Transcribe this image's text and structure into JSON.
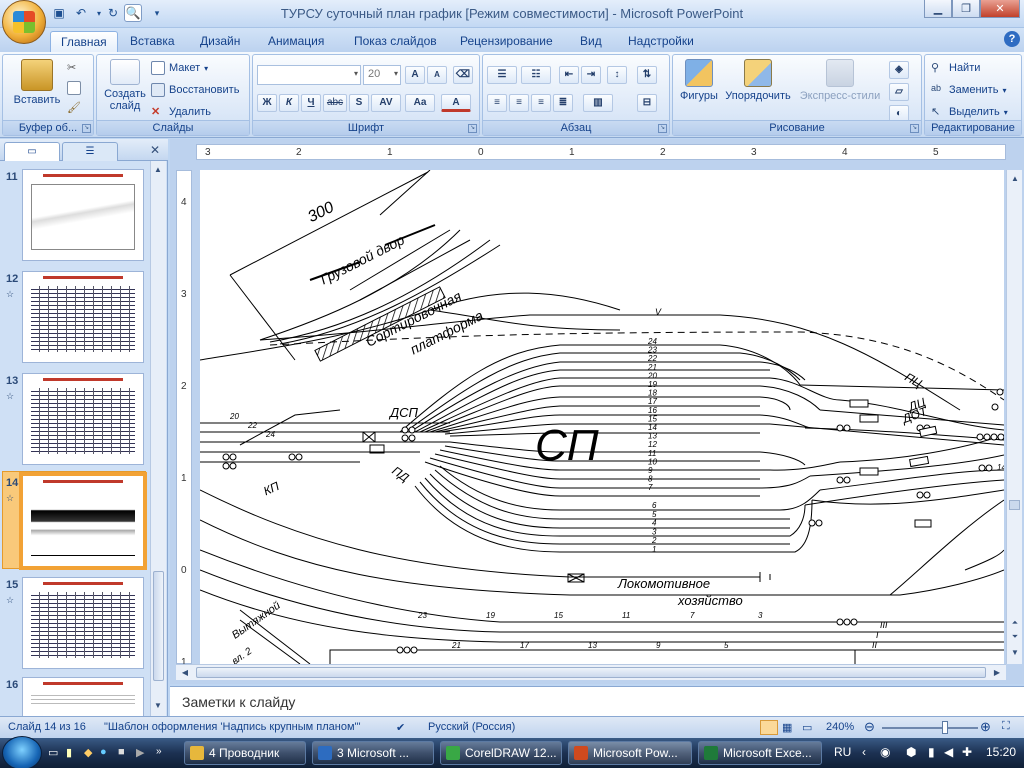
{
  "window": {
    "title": "ТУРСУ суточный план график [Режим совместимости] - Microsoft PowerPoint",
    "minimize_icon": "minimize-icon",
    "maximize_icon": "restore-icon",
    "close_icon": "close-icon"
  },
  "ribbon_tabs": [
    "Главная",
    "Вставка",
    "Дизайн",
    "Анимация",
    "Показ слайдов",
    "Рецензирование",
    "Вид",
    "Надстройки"
  ],
  "ribbon": {
    "clipboard": {
      "label": "Буфер об...",
      "paste": "Вставить"
    },
    "slides": {
      "label": "Слайды",
      "new_slide": "Создать слайд",
      "layout": "Макет",
      "reset": "Восстановить",
      "delete": "Удалить"
    },
    "font": {
      "label": "Шрифт",
      "size": "20",
      "bold": "Ж",
      "italic": "К",
      "underline": "Ч",
      "strike": "abc",
      "shadow": "S",
      "spacing": "AV",
      "case": "Aa",
      "color": "A"
    },
    "paragraph": {
      "label": "Абзац"
    },
    "drawing": {
      "label": "Рисование",
      "shapes": "Фигуры",
      "arrange": "Упорядочить",
      "quick_styles": "Экспресс-стили"
    },
    "editing": {
      "label": "Редактирование",
      "find": "Найти",
      "replace": "Заменить",
      "select": "Выделить"
    }
  },
  "slides_pane": {
    "thumbnails": [
      {
        "num": "11",
        "has_star": false,
        "selected": false
      },
      {
        "num": "12",
        "has_star": true,
        "selected": false
      },
      {
        "num": "13",
        "has_star": true,
        "selected": false
      },
      {
        "num": "14",
        "has_star": true,
        "selected": true
      },
      {
        "num": "15",
        "has_star": true,
        "selected": false
      },
      {
        "num": "16",
        "has_star": false,
        "selected": false
      }
    ]
  },
  "rulers": {
    "horizontal": [
      "3",
      "2",
      "1",
      "0",
      "1",
      "2",
      "3",
      "4",
      "5"
    ],
    "vertical": [
      "4",
      "3",
      "2",
      "1",
      "0",
      "1"
    ]
  },
  "slide": {
    "length_label": "300",
    "cargo_yard": "Грузовой двор",
    "platform_line1": "Сортировочная",
    "platform_line2": "платформа",
    "sp_label": "СП",
    "dsp_label": "ДСП",
    "pd_label": "ПД",
    "kp_label": "КП",
    "loco_line1": "Локомотивное",
    "loco_line2": "хозяйство",
    "pull_track": "Вытяжной",
    "track_v": "V",
    "track_iii": "III",
    "track_i": "I",
    "track_ii": "II",
    "right_labels": [
      "ПЦ",
      "ДЦ",
      "ДОТ"
    ],
    "upper_tracks": [
      "24",
      "23",
      "22",
      "21",
      "20",
      "19",
      "18",
      "17",
      "16",
      "15",
      "14",
      "13",
      "12",
      "11",
      "10",
      "9",
      "8",
      "7"
    ],
    "lower_tracks": [
      "6",
      "5",
      "4",
      "3",
      "2",
      "1"
    ],
    "switches_left": [
      "20",
      "22",
      "24"
    ],
    "switches_bottom": [
      "23",
      "21",
      "19",
      "17",
      "15",
      "13",
      "11",
      "9",
      "7",
      "5",
      "3"
    ],
    "switch_right": "14",
    "small_label": "вл. 2"
  },
  "notes": {
    "placeholder": "Заметки к слайду"
  },
  "status": {
    "slide_info": "Слайд 14 из 16",
    "theme": "\"Шаблон оформления 'Надпись крупным планом'\"",
    "language": "Русский (Россия)",
    "zoom": "240%"
  },
  "taskbar": {
    "items": [
      {
        "label": "4 Проводник",
        "color": "#e7b73c"
      },
      {
        "label": "3 Microsoft ...",
        "color": "#2d6cc0"
      },
      {
        "label": "CorelDRAW 12...",
        "color": "#39a845"
      },
      {
        "label": "Microsoft Pow...",
        "color": "#d04a1e"
      },
      {
        "label": "Microsoft Exce...",
        "color": "#1f7a3a"
      }
    ],
    "lang": "RU",
    "clock": "15:20"
  },
  "colors": {
    "ribbon_text": "#15428b",
    "selection": "#f2a235"
  }
}
